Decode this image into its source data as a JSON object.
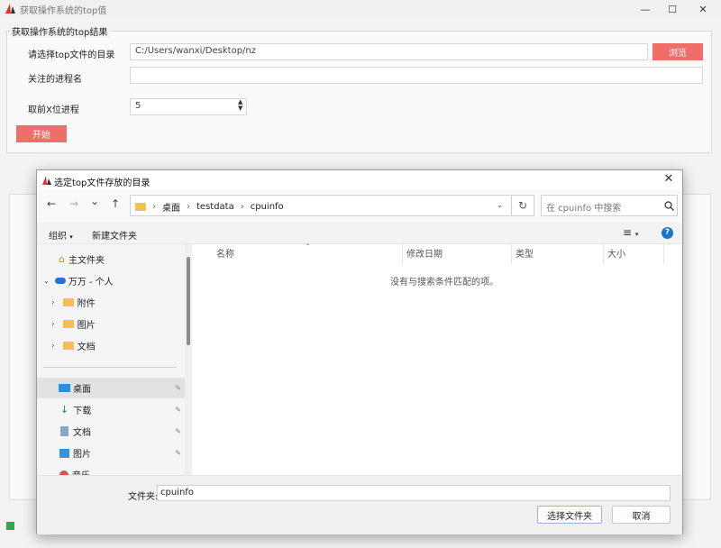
{
  "app": {
    "title": "获取操作系统的top值",
    "minimize": "—",
    "maximize": "☐",
    "close": "✕"
  },
  "form": {
    "group_title": "获取操作系统的top结果",
    "dir_label": "请选择top文件的目录",
    "dir_value": "C:/Users/wanxi/Desktop/nz",
    "browse_button": "浏览",
    "process_label": "关注的进程名",
    "process_value": "",
    "topn_label": "取前X位进程",
    "topn_value": "5",
    "start_button": "开始"
  },
  "dialog": {
    "title": "选定top文件存放的目录",
    "close": "✕",
    "nav": {
      "back": "←",
      "forward": "→",
      "recent": "⌄",
      "up": "↑"
    },
    "breadcrumb": [
      "桌面",
      "testdata",
      "cpuinfo"
    ],
    "breadcrumb_sep": "›",
    "search_placeholder": "在 cpuinfo 中搜索",
    "toolbar": {
      "organize": "组织",
      "new_folder": "新建文件夹",
      "view_icon": "≡",
      "help": "?"
    },
    "nav_pane": {
      "home": "主文件夹",
      "onedrive": "万万 - 个人",
      "od_children": [
        "附件",
        "图片",
        "文档"
      ],
      "quick": [
        "桌面",
        "下载",
        "文档",
        "图片",
        "音乐"
      ]
    },
    "columns": [
      "名称",
      "修改日期",
      "类型",
      "大小"
    ],
    "empty_text": "没有与搜索条件匹配的项。",
    "folder_label": "文件夹:",
    "folder_value": "cpuinfo",
    "select_button": "选择文件夹",
    "cancel_button": "取消"
  },
  "colors": {
    "accent_red": "#ee6f6a",
    "help_blue": "#1a73c9"
  }
}
